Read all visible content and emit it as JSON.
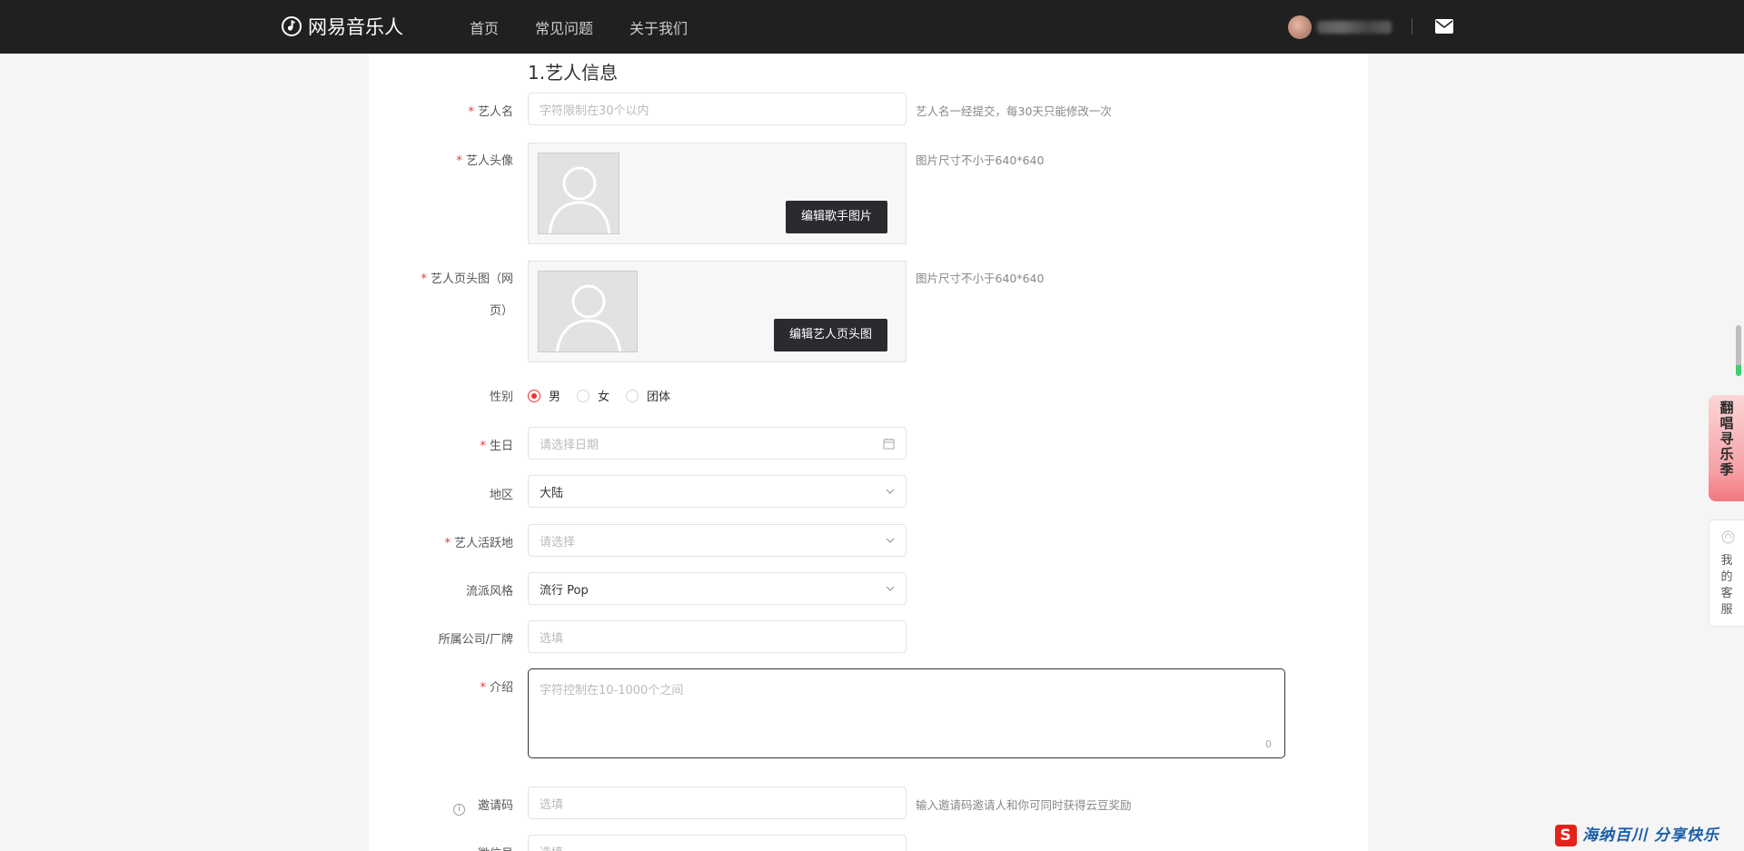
{
  "header": {
    "brand": "网易音乐人",
    "nav": [
      "首页",
      "常见问题",
      "关于我们"
    ]
  },
  "form": {
    "section_title": "1.艺人信息",
    "artist_name": {
      "label": "艺人名",
      "placeholder": "字符限制在30个以内",
      "hint": "艺人名一经提交，每30天只能修改一次"
    },
    "avatar": {
      "label": "艺人头像",
      "button": "编辑歌手图片",
      "hint": "图片尺寸不小于640*640"
    },
    "banner": {
      "label_line1": "艺人页头图（网",
      "label_line2": "页）",
      "button": "编辑艺人页头图",
      "hint": "图片尺寸不小于640*640"
    },
    "gender": {
      "label": "性别",
      "options": [
        "男",
        "女",
        "团体"
      ],
      "selected": "男"
    },
    "birthday": {
      "label": "生日",
      "placeholder": "请选择日期"
    },
    "region": {
      "label": "地区",
      "value": "大陆"
    },
    "active_area": {
      "label": "艺人活跃地",
      "placeholder": "请选择"
    },
    "genre": {
      "label": "流派风格",
      "value": "流行 Pop"
    },
    "company": {
      "label": "所属公司/厂牌",
      "placeholder": "选填"
    },
    "intro": {
      "label": "介绍",
      "placeholder": "字符控制在10-1000个之间",
      "count": "0"
    },
    "invite_code": {
      "label": "邀请码",
      "placeholder": "选填",
      "hint": "输入邀请码邀请人和你可同时获得云豆奖励"
    },
    "next_field": {
      "label": "微信号",
      "placeholder": "选填"
    }
  },
  "side": {
    "promo": [
      "翻",
      "唱",
      "寻",
      "乐",
      "季"
    ],
    "service": [
      "我",
      "的",
      "客",
      "服"
    ]
  },
  "watermark": "海纳百川 分享快乐",
  "colors": {
    "topbar": "#202020",
    "required": "#e33333",
    "button_dark": "#2b2b2f"
  }
}
